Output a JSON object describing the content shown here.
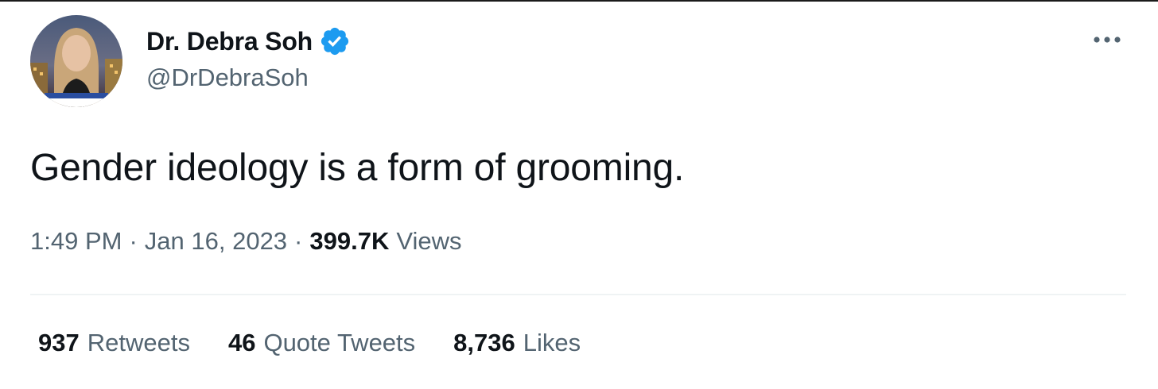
{
  "author": {
    "name": "Dr. Debra Soh",
    "handle": "@DrDebraSoh",
    "verified": true,
    "avatar_icon": "profile-photo"
  },
  "menu_icon": "more-horizontal-icon",
  "tweet": {
    "text": "Gender ideology is a form of grooming."
  },
  "meta": {
    "time": "1:49 PM",
    "separator": "·",
    "date": "Jan 16, 2023",
    "views_count": "399.7K",
    "views_label": "Views"
  },
  "stats": {
    "retweets_count": "937",
    "retweets_label": "Retweets",
    "quotes_count": "46",
    "quotes_label": "Quote Tweets",
    "likes_count": "8,736",
    "likes_label": "Likes"
  },
  "colors": {
    "text_primary": "#0f1419",
    "text_secondary": "#536471",
    "verified_blue": "#1d9bf0",
    "divider": "#eff3f4"
  }
}
